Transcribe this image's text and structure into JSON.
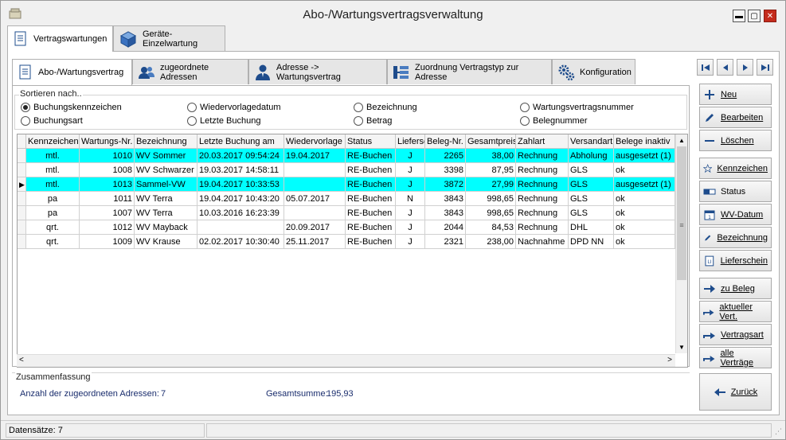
{
  "window": {
    "title": "Abo-/Wartungsvertragsverwaltung"
  },
  "top_tabs": [
    {
      "label": "Vertragswartungen"
    },
    {
      "label": "Geräte-Einzelwartung"
    }
  ],
  "inner_tabs": [
    {
      "label": "Abo-/Wartungsvertrag"
    },
    {
      "label": "zugeordnete Adressen"
    },
    {
      "label": "Adresse -> Wartungsvertrag"
    },
    {
      "label": "Zuordnung Vertragstyp zur Adresse"
    },
    {
      "label": "Konfiguration"
    }
  ],
  "sort": {
    "legend": "Sortieren nach..",
    "options": [
      {
        "label": "Buchungskennzeichen",
        "checked": true
      },
      {
        "label": "Wiedervorlagedatum",
        "checked": false
      },
      {
        "label": "Bezeichnung",
        "checked": false
      },
      {
        "label": "Wartungsvertragsnummer",
        "checked": false
      },
      {
        "label": "Buchungsart",
        "checked": false
      },
      {
        "label": "Letzte Buchung",
        "checked": false
      },
      {
        "label": "Betrag",
        "checked": false
      },
      {
        "label": "Belegnummer",
        "checked": false
      }
    ]
  },
  "grid": {
    "columns": [
      "Kennzeichen",
      "Wartungs-Nr.",
      "Bezeichnung",
      "Letzte Buchung am",
      "Wiedervorlage",
      "Status",
      "Lieferschein",
      "Beleg-Nr.",
      "Gesamtpreis",
      "Zahlart",
      "Versandart",
      "Belege inaktiv"
    ],
    "rows": [
      [
        "mtl.",
        "1010",
        "WV Sommer",
        "20.03.2017 09:54:24",
        "19.04.2017",
        "RE-Buchen",
        "J",
        "2265",
        "38,00",
        "Rechnung",
        "Abholung",
        "ausgesetzt (1)"
      ],
      [
        "mtl.",
        "1008",
        "WV Schwarzer",
        "19.03.2017 14:58:11",
        "",
        "RE-Buchen",
        "J",
        "3398",
        "87,95",
        "Rechnung",
        "GLS",
        "ok"
      ],
      [
        "mtl.",
        "1013",
        "Sammel-VW",
        "19.04.2017 10:33:53",
        "",
        "RE-Buchen",
        "J",
        "3872",
        "27,99",
        "Rechnung",
        "GLS",
        "ausgesetzt (1)"
      ],
      [
        "pa",
        "1011",
        "WV Terra",
        "19.04.2017 10:43:20",
        "05.07.2017",
        "RE-Buchen",
        "N",
        "3843",
        "998,65",
        "Rechnung",
        "GLS",
        "ok"
      ],
      [
        "pa",
        "1007",
        "WV Terra",
        "10.03.2016 16:23:39",
        "",
        "RE-Buchen",
        "J",
        "3843",
        "998,65",
        "Rechnung",
        "GLS",
        "ok"
      ],
      [
        "qrt.",
        "1012",
        "WV Mayback",
        "",
        "20.09.2017",
        "RE-Buchen",
        "J",
        "2044",
        "84,53",
        "Rechnung",
        "DHL",
        "ok"
      ],
      [
        "qrt.",
        "1009",
        "WV Krause",
        "02.02.2017 10:30:40",
        "25.11.2017",
        "RE-Buchen",
        "J",
        "2321",
        "238,00",
        "Nachnahme",
        "DPD NN",
        "ok"
      ]
    ],
    "selected_rows": [
      0,
      2
    ],
    "current_row": 2
  },
  "summary": {
    "legend": "Zusammenfassung",
    "addresses_label": "Anzahl der zugeordneten Adressen:",
    "addresses_value": "7",
    "total_label": "Gesamtsumme:",
    "total_value": "195,93"
  },
  "buttons": {
    "new": "Neu",
    "edit": "Bearbeiten",
    "delete": "Löschen",
    "flag": "Kennzeichen",
    "status": "Status",
    "wv_date": "WV-Datum",
    "designation": "Bezeichnung",
    "delivery": "Lieferschein",
    "to_receipt": "zu Beleg",
    "current_contract": "aktueller Vert.",
    "contract_type": "Vertragsart",
    "all_contracts": "alle Verträge",
    "back": "Zurück"
  },
  "statusbar": {
    "records": "Datensätze: 7"
  }
}
